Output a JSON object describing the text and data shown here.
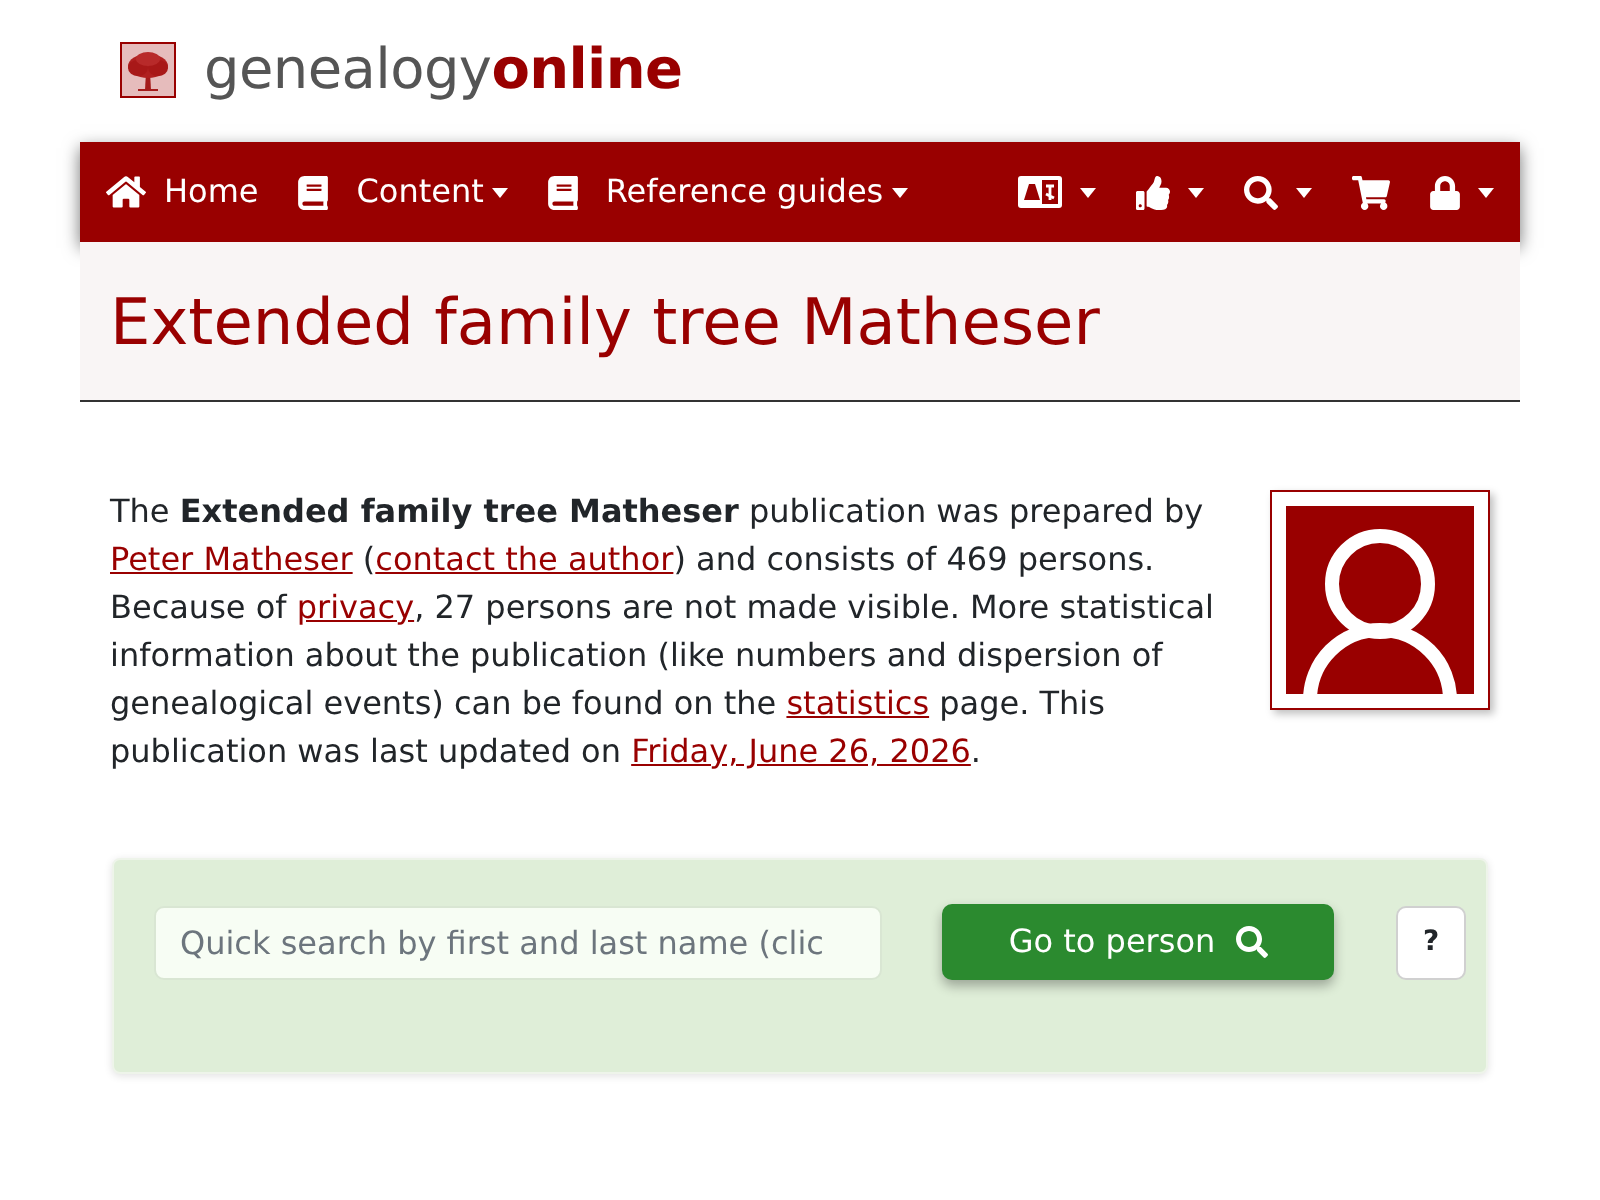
{
  "logo": {
    "name": "genealogy",
    "name_bold": "online"
  },
  "nav": {
    "links": [
      {
        "kind": "home",
        "label": "Home",
        "dropdown": false
      },
      {
        "kind": "book",
        "label": "Content",
        "dropdown": true
      },
      {
        "kind": "book",
        "label": "Reference guides",
        "dropdown": true
      }
    ],
    "icon_menus": [
      {
        "kind": "language",
        "dropdown": true
      },
      {
        "kind": "like",
        "dropdown": true
      },
      {
        "kind": "search",
        "dropdown": true
      },
      {
        "kind": "cart",
        "dropdown": false
      },
      {
        "kind": "lock",
        "dropdown": true
      }
    ]
  },
  "page_title": "Extended family tree Matheser",
  "intro": {
    "parts": [
      {
        "kind": "text",
        "text": "The **Extended family tree Matheser** publication was prepared by "
      },
      {
        "kind": "link",
        "text": "Peter Matheser"
      },
      {
        "kind": "text",
        "text": " ("
      },
      {
        "kind": "link",
        "text": "contact the author"
      },
      {
        "kind": "text",
        "text": ") and consists of 469 persons. Because of "
      },
      {
        "kind": "link",
        "text": "privacy"
      },
      {
        "kind": "text",
        "text": ", 27 persons are not made visible. More statistical information about the publication (like numbers and dispersion of genealogical events) can be found on the "
      },
      {
        "kind": "link",
        "text": "statistics"
      },
      {
        "kind": "text",
        "text": " page. This publication was last updated on "
      },
      {
        "kind": "link",
        "text": "Friday, June 26, 2026"
      },
      {
        "kind": "text",
        "text": "."
      }
    ]
  },
  "search": {
    "placeholder": "Quick search by first and last name (clic",
    "button": "Go to person",
    "help": "?"
  }
}
